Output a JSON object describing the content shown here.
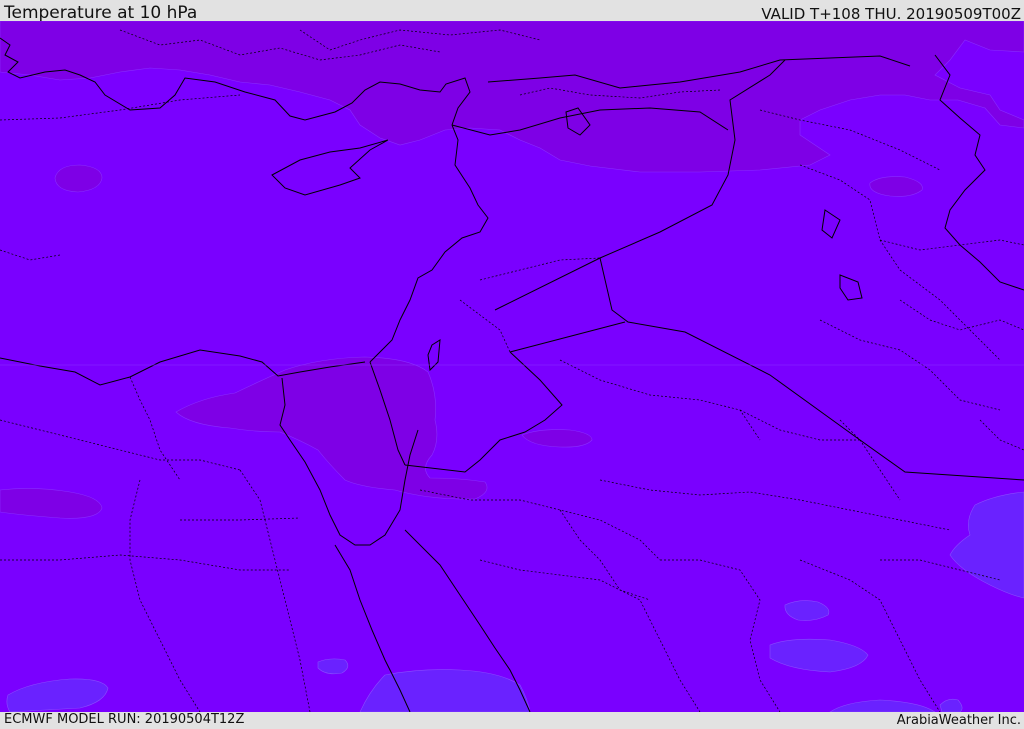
{
  "header": {
    "title": "Temperature at 10 hPa",
    "valid": "VALID T+108 THU. 20190509T00Z"
  },
  "footer": {
    "model_run": "ECMWF MODEL RUN: 20190504T12Z",
    "credit": "ArabiaWeather Inc."
  },
  "map": {
    "colors": {
      "base": "#7a00ff",
      "warmer": "#7e00e8",
      "cooler": "#6c22ff",
      "border": "#000000"
    }
  }
}
